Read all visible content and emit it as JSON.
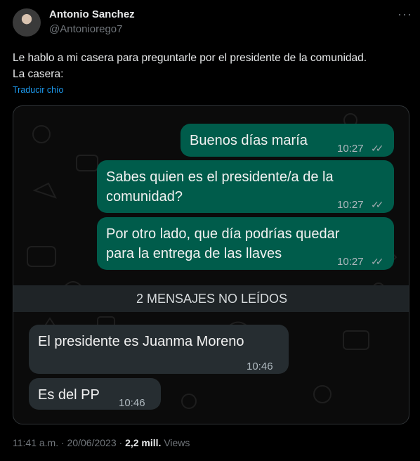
{
  "author": {
    "name": "Antonio Sanchez",
    "handle": "@Antoniorego7"
  },
  "more_icon": "more-horizontal-icon",
  "tweet": {
    "line1": "Le hablo a mi casera para preguntarle por el presidente de la comunidad.",
    "line2": "La casera:",
    "translate": "Traducir chío"
  },
  "chat": {
    "messages_out": [
      {
        "lines": [
          "Buenos días maría"
        ],
        "time": "10:27"
      },
      {
        "lines": [
          "Sabes quien es el presidente/a de la",
          "comunidad?"
        ],
        "time": "10:27"
      },
      {
        "lines": [
          "Por otro lado, que día podrías quedar",
          "para la entrega de las llaves"
        ],
        "time": "10:27"
      }
    ],
    "unread_banner": "2 MENSAJES NO LEÍDOS",
    "messages_in": [
      {
        "text": "El presidente es Juanma Moreno",
        "time": "10:46"
      },
      {
        "text": "Es del PP",
        "time": "10:46"
      }
    ],
    "colors": {
      "outgoing": "#005c4b",
      "incoming": "#262d31"
    }
  },
  "meta": {
    "timestamp": "11:41 a.m. · 20/06/2023 ·",
    "views_count": "2,2 mill.",
    "views_label": "Views"
  }
}
